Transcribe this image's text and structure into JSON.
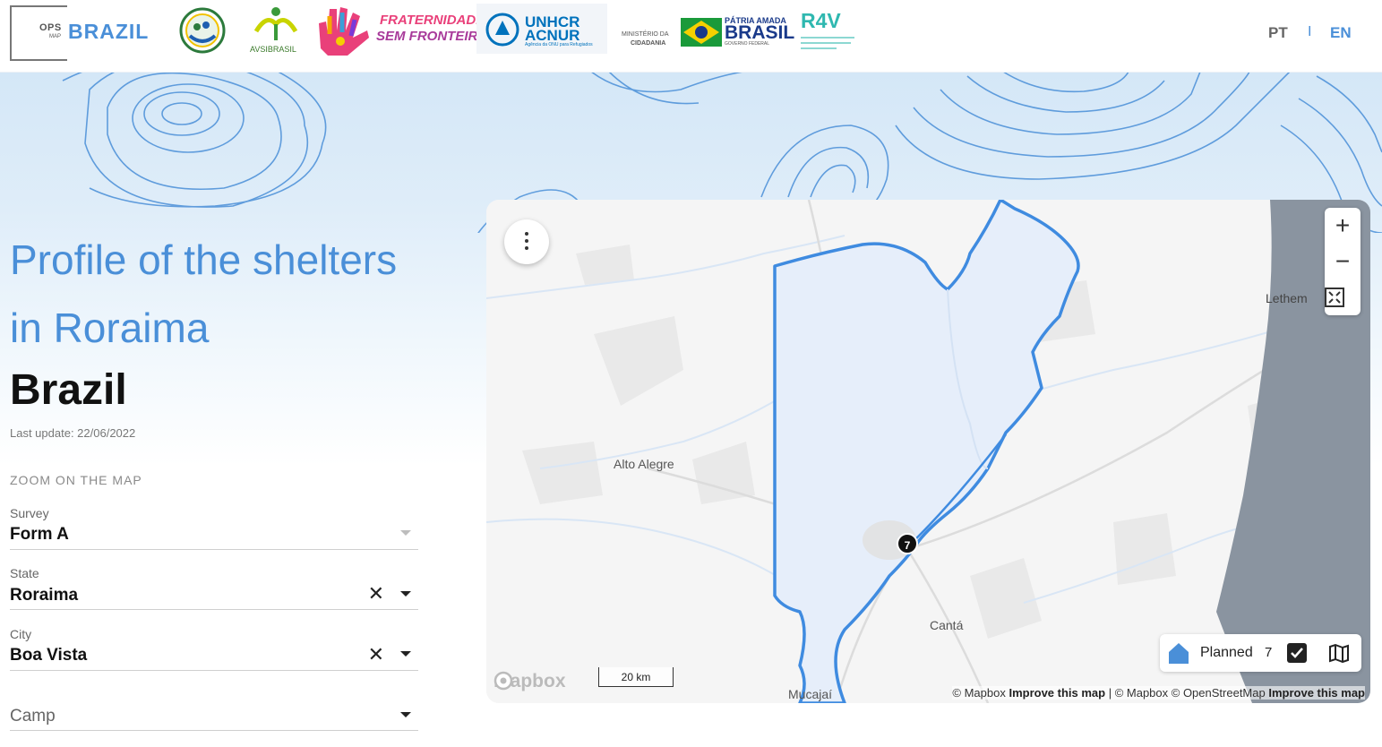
{
  "header": {
    "logo_ops": "OPS",
    "logo_map": "MAP",
    "logo_brand": "BRAZIL",
    "partners": {
      "avsi": "AVSIBRASIL",
      "fraternidade_1": "FRATERNIDADE",
      "fraternidade_2": "SEM FRONTEIRAS",
      "unhcr_1": "UNHCR",
      "unhcr_2": "ACNUR",
      "unhcr_3": "Agência da ONU para Refugiados",
      "ministerio_1": "MINISTÉRIO DA",
      "ministerio_2": "CIDADANIA",
      "patria_1": "PÁTRIA AMADA",
      "patria_2": "BRASIL",
      "patria_3": "GOVERNO FEDERAL",
      "r4v": "R4V"
    },
    "languages": [
      "PT",
      "EN"
    ],
    "lang_separator": "I",
    "active_language": "EN"
  },
  "page": {
    "title": "Profile of the shelters in Roraima",
    "country": "Brazil",
    "last_update": "Last update: 22/06/2022",
    "zoom_section_label": "ZOOM ON THE MAP"
  },
  "filters": {
    "survey": {
      "label": "Survey",
      "value": "Form A"
    },
    "state": {
      "label": "State",
      "value": "Roraima"
    },
    "city": {
      "label": "City",
      "value": "Boa Vista"
    },
    "camp": {
      "placeholder": "Camp"
    }
  },
  "map": {
    "place_labels": {
      "alto_alegre": "Alto Alegre",
      "canta": "Cantá",
      "lethem": "Lethem",
      "mucajai": "Mucajaí"
    },
    "cluster_count": "7",
    "zoom_in": "+",
    "zoom_out": "−",
    "scale_label": "20 km",
    "mapbox_logo": "mapbox",
    "attribution": {
      "part1": "© Mapbox",
      "improve1": "Improve this map",
      "part2": "| © Mapbox © OpenStreetMap",
      "improve2": "Improve this map"
    },
    "legend": {
      "label": "Planned",
      "count": "7",
      "checked": true
    }
  },
  "colors": {
    "accent": "#4a8fd8",
    "boundary": "#3f8be0",
    "region_fill": "#e6eefa",
    "neighbor_country": "#8a94a0"
  }
}
